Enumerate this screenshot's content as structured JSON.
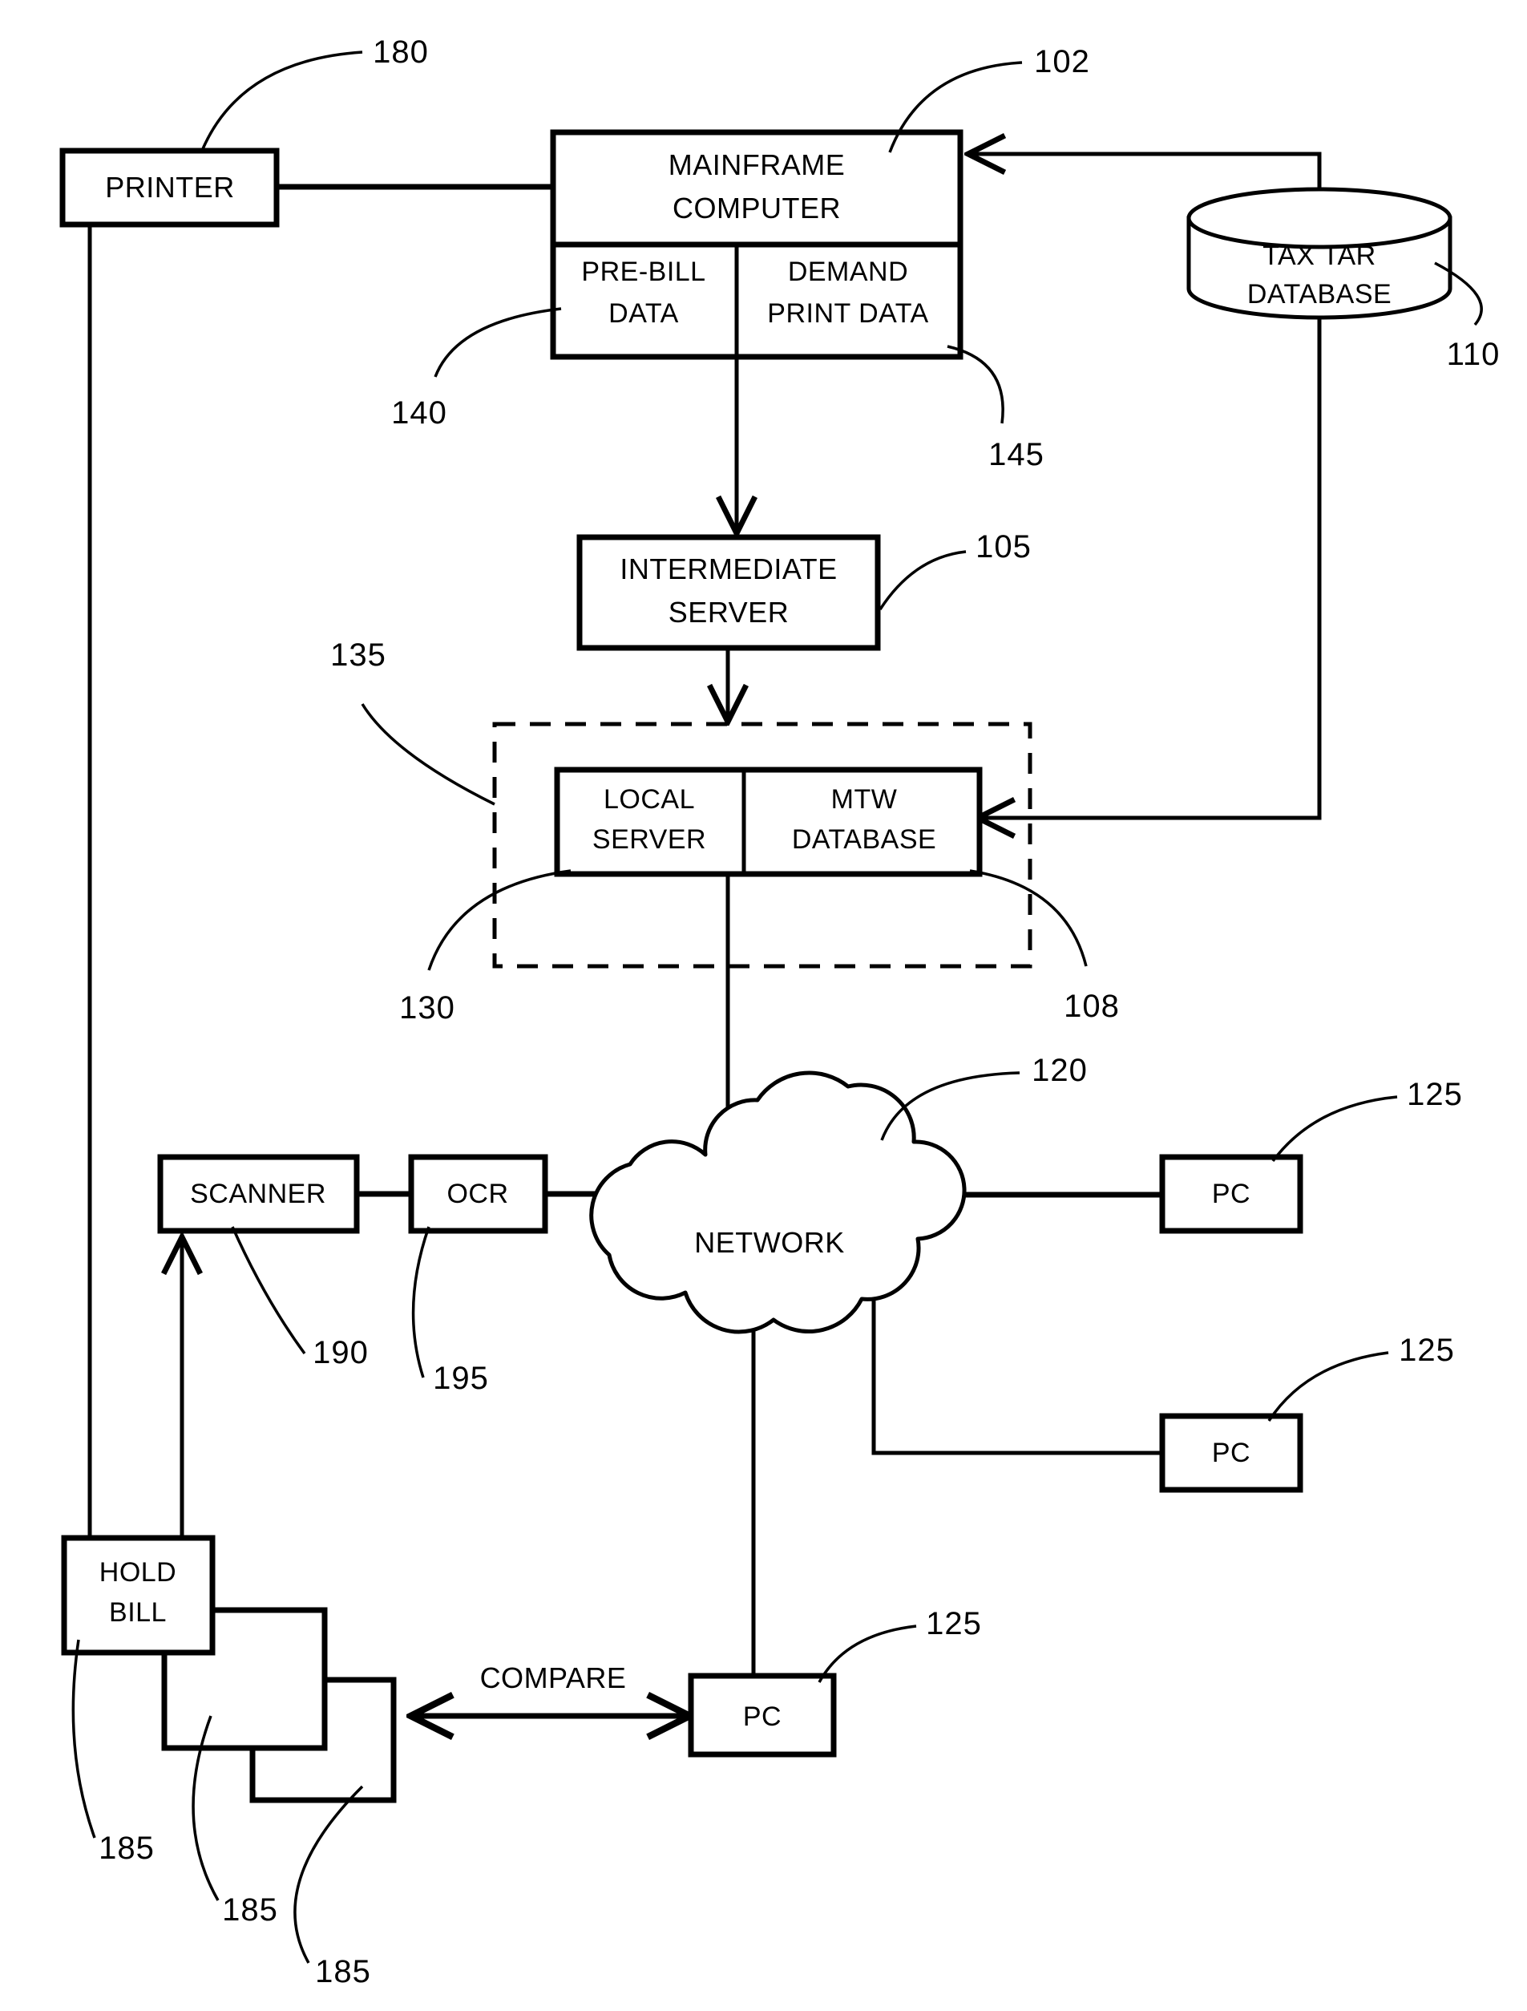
{
  "figure": {
    "type": "patent-system-block-diagram",
    "nodes": {
      "printer": {
        "label": "PRINTER",
        "ref": "180"
      },
      "mainframe": {
        "label_line1": "MAINFRAME",
        "label_line2": "COMPUTER",
        "ref": "102"
      },
      "prebill": {
        "label_line1": "PRE-BILL",
        "label_line2": "DATA",
        "ref": "140"
      },
      "demand_print": {
        "label_line1": "DEMAND",
        "label_line2": "PRINT DATA",
        "ref": "145"
      },
      "tax_tar_db": {
        "label_line1": "TAX TAR",
        "label_line2": "DATABASE",
        "ref": "110"
      },
      "intermediate_server": {
        "label_line1": "INTERMEDIATE",
        "label_line2": "SERVER",
        "ref": "105"
      },
      "local_server": {
        "label_line1": "LOCAL",
        "label_line2": "SERVER",
        "ref": "130"
      },
      "mtw_db": {
        "label_line1": "MTW",
        "label_line2": "DATABASE",
        "ref": "108"
      },
      "dashed_group": {
        "ref": "135"
      },
      "network": {
        "label": "NETWORK",
        "ref": "120"
      },
      "scanner": {
        "label": "SCANNER",
        "ref": "190"
      },
      "ocr": {
        "label": "OCR",
        "ref": "195"
      },
      "pc_top": {
        "label": "PC",
        "ref": "125"
      },
      "pc_middle": {
        "label": "PC",
        "ref": "125"
      },
      "pc_bottom": {
        "label": "PC",
        "ref": "125"
      },
      "hold_bill": {
        "label_line1": "HOLD",
        "label_line2": "BILL",
        "ref": "185"
      },
      "bill_sheet_2": {
        "ref": "185"
      },
      "bill_sheet_3": {
        "ref": "185"
      }
    },
    "edge_labels": {
      "compare": "COMPARE"
    },
    "reference_numerals": [
      "180",
      "102",
      "140",
      "145",
      "110",
      "105",
      "135",
      "130",
      "108",
      "120",
      "125",
      "190",
      "195",
      "185"
    ],
    "colors": {
      "line": "#000000",
      "background": "#ffffff"
    }
  }
}
